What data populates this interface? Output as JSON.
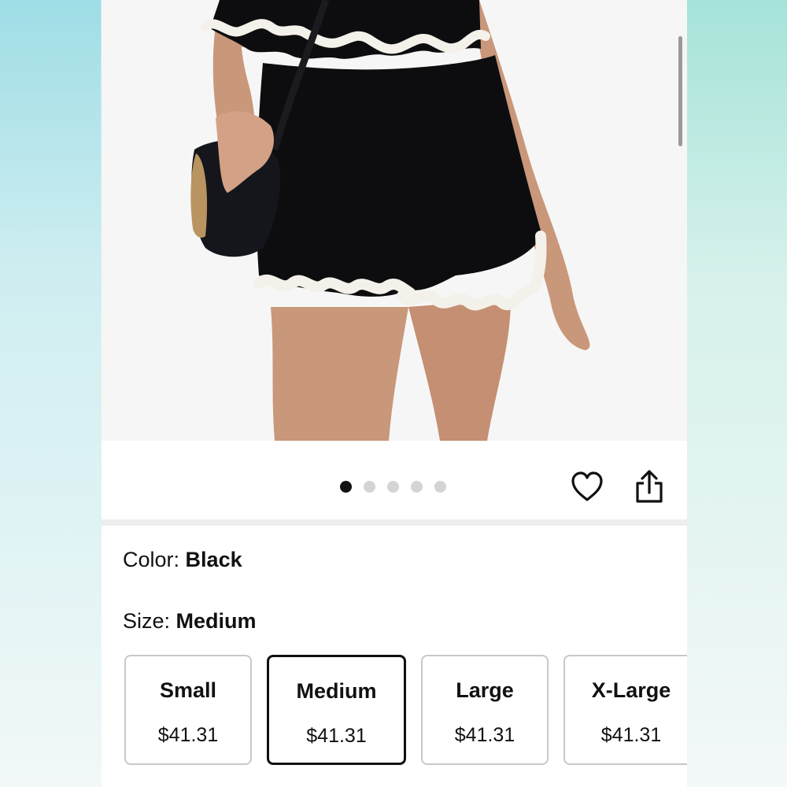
{
  "gallery": {
    "dot_count": 5,
    "active_index": 0
  },
  "variations": {
    "color": {
      "label": "Color:",
      "value": "Black"
    },
    "size": {
      "label": "Size:",
      "value": "Medium"
    }
  },
  "sizes": [
    {
      "name": "Small",
      "price": "$41.31",
      "selected": false
    },
    {
      "name": "Medium",
      "price": "$41.31",
      "selected": true
    },
    {
      "name": "Large",
      "price": "$41.31",
      "selected": false
    },
    {
      "name": "X-Large",
      "price": "$41.31",
      "selected": false
    }
  ],
  "colors": {
    "trim": "#f4f1ea",
    "garment": "#0d0d10",
    "skin": "#c9977a"
  },
  "icons": [
    "heart-icon",
    "share-icon"
  ]
}
